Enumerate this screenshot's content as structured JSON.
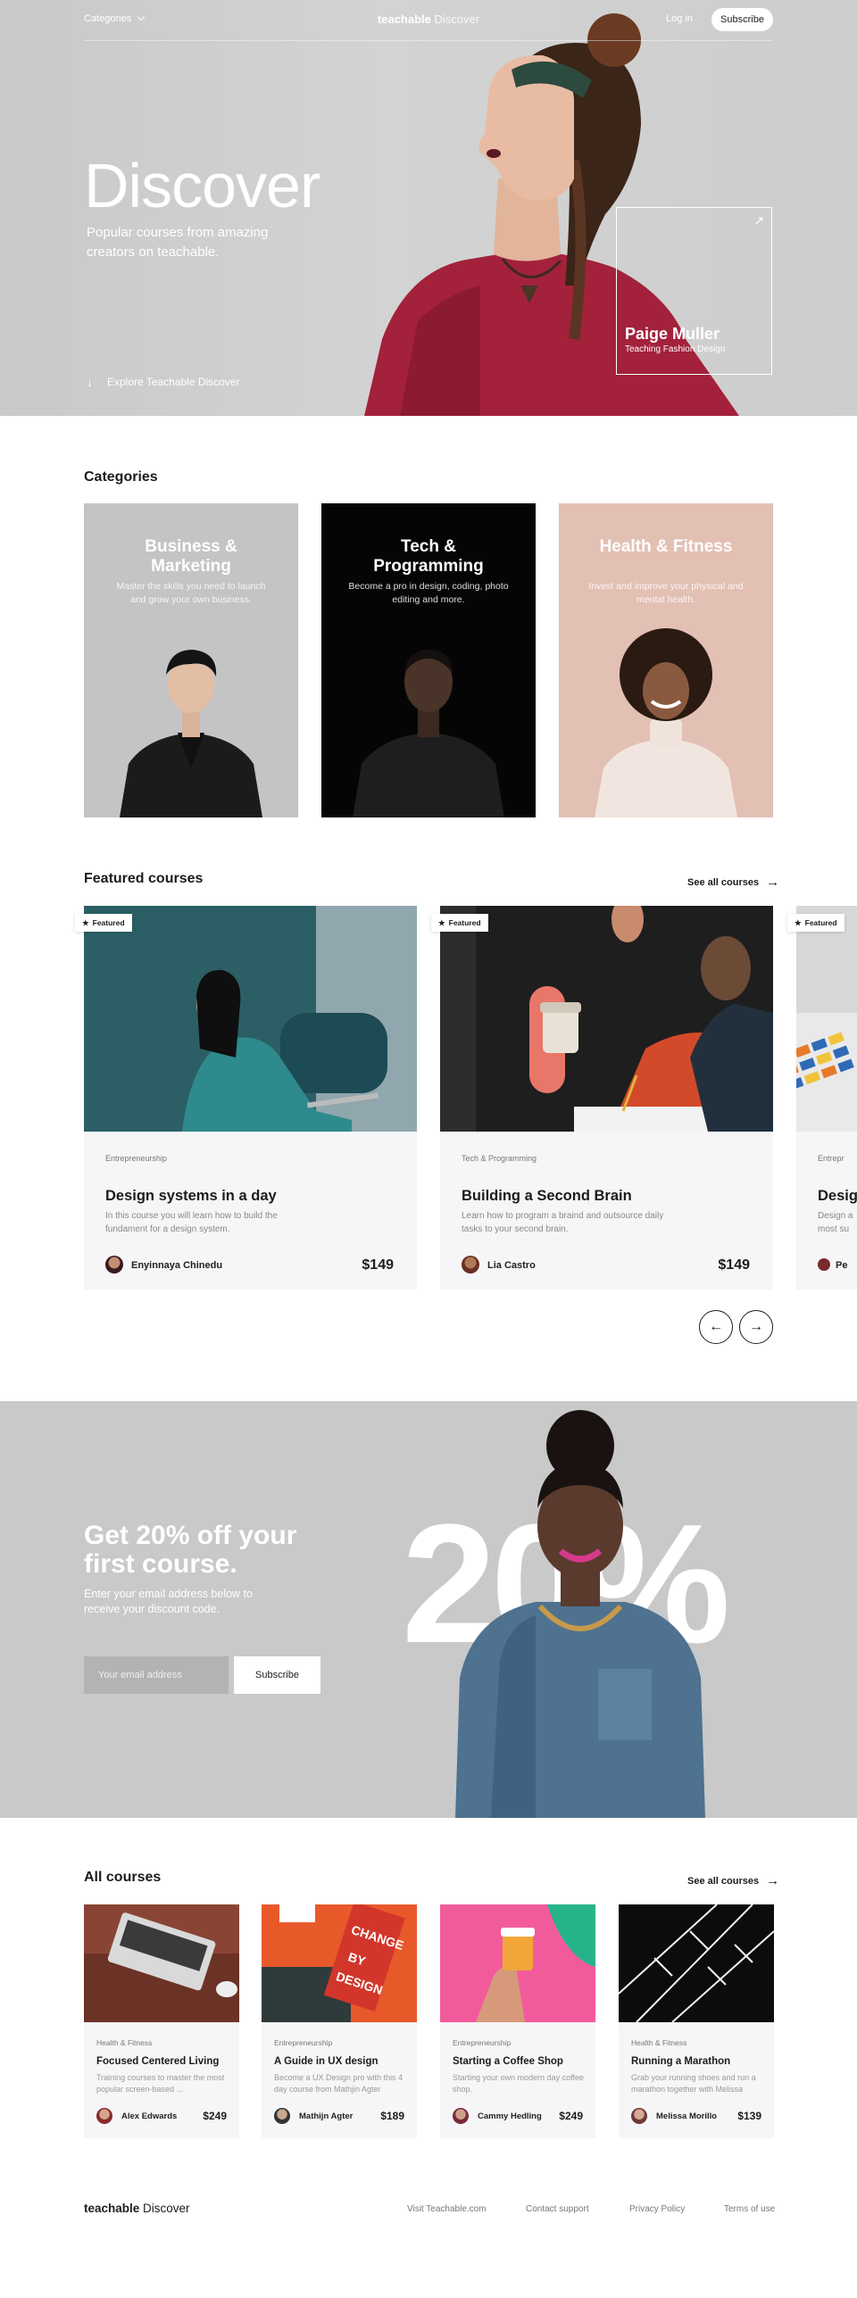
{
  "nav": {
    "categories_label": "Categories",
    "logo_bold": "teachable",
    "logo_light": "Discover",
    "login_label": "Log in",
    "subscribe_label": "Subscribe"
  },
  "hero": {
    "title": "Discover",
    "subtitle": "Popular courses from amazing creators on teachable.",
    "explore_label": "Explore Teachable Discover",
    "credit_name": "Paige Muller",
    "credit_role": "Teaching Fashion Design"
  },
  "categories": {
    "heading": "Categories",
    "items": [
      {
        "title": "Business & Marketing",
        "desc": "Master the skills you need to launch and grow your own business.",
        "bg": "#c4c4c4"
      },
      {
        "title": "Tech & Programming",
        "desc": "Become a pro in design, coding, photo editing and more.",
        "bg": "#050505"
      },
      {
        "title": "Health & Fitness",
        "desc": "Invest and improve your physical and mental health.",
        "bg": "#e3c0b4"
      }
    ]
  },
  "featured": {
    "heading": "Featured courses",
    "see_all_label": "See all courses",
    "badge_label": "Featured",
    "items": [
      {
        "category": "Entrepreneurship",
        "title": "Design systems in a day",
        "desc": "In this course you will learn how to build the fundament for a design system.",
        "author": "Enyinnaya Chinedu",
        "price": "$149"
      },
      {
        "category": "Tech & Programming",
        "title": "Building a Second Brain",
        "desc": "Learn how to program a braind and outsource daily tasks to your second brain.",
        "author": "Lia Castro",
        "price": "$149"
      },
      {
        "category": "Entrepr",
        "title": "Desig",
        "desc": "Design a most su",
        "author": "Pe",
        "price": ""
      }
    ]
  },
  "promo": {
    "title": "Get 20% off your first course.",
    "subtitle": "Enter your email address below to receive your discount code.",
    "email_placeholder": "Your email address",
    "subscribe_label": "Subscribe",
    "big_text": "20%"
  },
  "all_courses": {
    "heading": "All courses",
    "see_all_label": "See all courses",
    "items": [
      {
        "category": "Health & Fitness",
        "title": "Focused Centered Living",
        "desc": "Training courses to master the most popular screen-based ...",
        "author": "Alex Edwards",
        "price": "$249"
      },
      {
        "category": "Entrepreneurship",
        "title": "A Guide in UX design",
        "desc": "Become a UX Design pro with this 4 day course from Mathjin Agter",
        "author": "Mathijn Agter",
        "price": "$189"
      },
      {
        "category": "Entrepreneurship",
        "title": "Starting a Coffee Shop",
        "desc": "Starting your own modern day coffee shop.",
        "author": "Cammy Hedling",
        "price": "$249"
      },
      {
        "category": "Health & Fitness",
        "title": "Running a Marathon",
        "desc": "Grab your running shoes and run a marathon together with Melissa",
        "author": "Melissa Morillo",
        "price": "$139"
      }
    ]
  },
  "footer": {
    "logo_bold": "teachable",
    "logo_light": "Discover",
    "links": [
      "Visit Teachable.com",
      "Contact support",
      "Privacy Policy",
      "Terms of use"
    ]
  }
}
